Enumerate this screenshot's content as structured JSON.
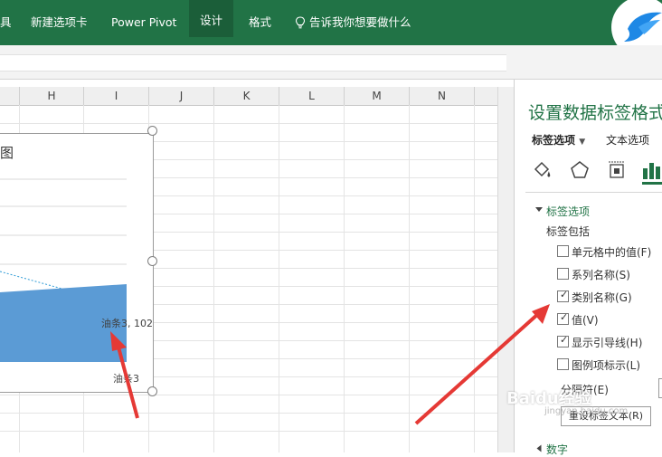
{
  "ribbon": {
    "tabs": [
      "具",
      "新建选项卡",
      "Power Pivot",
      "设计",
      "格式"
    ],
    "active_tabs": [
      "设计"
    ],
    "tell_me": "告诉我你想要做什么",
    "color": "#217346"
  },
  "sheet": {
    "columns": [
      "H",
      "I",
      "J",
      "K",
      "L",
      "M",
      "N"
    ]
  },
  "chart": {
    "title_partial": "图",
    "label_point": "油条3, 102",
    "label_axis": "油条3",
    "fill_color": "#5b9bd5"
  },
  "chart_data": {
    "type": "area",
    "categories": [
      "油条3"
    ],
    "series": [
      {
        "values": [
          102
        ]
      }
    ],
    "data_labels": [
      "油条3, 102"
    ]
  },
  "pane": {
    "title": "设置数据标签格式",
    "tabs": [
      "标签选项",
      "文本选项"
    ],
    "section_label_options": "标签选项",
    "label_contains": "标签包括",
    "checkboxes": [
      {
        "label": "单元格中的值(F)",
        "checked": false
      },
      {
        "label": "系列名称(S)",
        "checked": false
      },
      {
        "label": "类别名称(G)",
        "checked": true
      },
      {
        "label": "值(V)",
        "checked": true
      },
      {
        "label": "显示引导线(H)",
        "checked": true
      },
      {
        "label": "图例项标示(L)",
        "checked": false
      }
    ],
    "separator_label": "分隔符(E)",
    "reset_button": "重设标签文本(R)",
    "section_number": "数字",
    "icons": [
      "fill-icon",
      "pentagon-icon",
      "size-properties-icon",
      "bar-chart-icon"
    ]
  },
  "watermark": {
    "text": "Baidu经验",
    "sub": "jingyan.baidu.com"
  }
}
